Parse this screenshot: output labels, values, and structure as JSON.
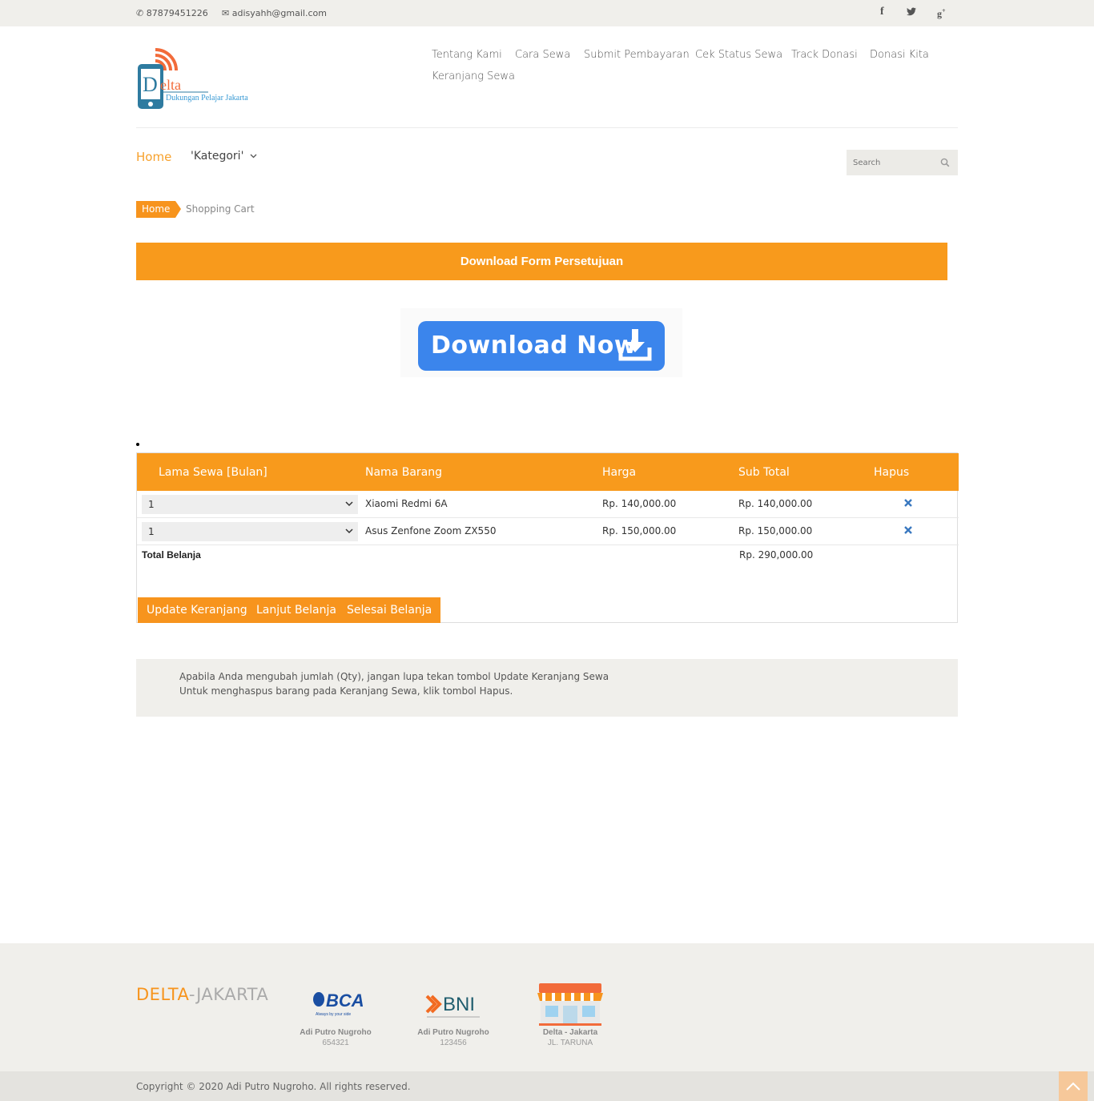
{
  "topbar": {
    "phone": "87879451226",
    "email": "adisyahh@gmail.com",
    "social": [
      "facebook-icon",
      "twitter-icon",
      "google-plus-icon"
    ]
  },
  "logo": {
    "letter": "D",
    "name": "elta",
    "tagline": "Dukungan Pelajar Jakarta"
  },
  "nav_top": [
    "Tentang Kami",
    "Cara Sewa",
    "Submit Pembayaran",
    "Cek Status Sewa",
    "Track Donasi",
    "Donasi Kita",
    "Keranjang Sewa"
  ],
  "menu": {
    "home": "Home",
    "kategori": "'Kategori'"
  },
  "search": {
    "placeholder": "Search"
  },
  "breadcrumb": {
    "home": "Home",
    "current": "Shopping Cart"
  },
  "download_form_label": "Download Form Persetujuan",
  "download_now_label": "Download Now",
  "cart": {
    "headers": [
      "Lama Sewa [Bulan]",
      "Nama Barang",
      "Harga",
      "Sub Total",
      "Hapus"
    ],
    "rows": [
      {
        "qty": "1",
        "name": "Xiaomi Redmi 6A",
        "price": "Rp. 140,000.00",
        "subtotal": "Rp. 140,000.00"
      },
      {
        "qty": "1",
        "name": "Asus Zenfone Zoom ZX550",
        "price": "Rp. 150,000.00",
        "subtotal": "Rp. 150,000.00"
      }
    ],
    "total_label": "Total Belanja",
    "total_value": "Rp. 290,000.00",
    "buttons": [
      "Update Keranjang",
      "Lanjut Belanja",
      "Selesai Belanja"
    ]
  },
  "note": [
    "Apabila Anda mengubah jumlah (Qty), jangan lupa tekan tombol Update Keranjang Sewa",
    "Untuk menghaspus barang pada Keranjang Sewa, klik tombol Hapus."
  ],
  "footer": {
    "brand_a": "DELTA",
    "brand_b": "-JAKARTA",
    "items": [
      {
        "logo": "BCA",
        "slogan": "Always by your side",
        "name": "Adi Putro Nugroho",
        "value": "654321"
      },
      {
        "logo": "BNI",
        "name": "Adi Putro Nugroho",
        "value": "123456"
      },
      {
        "logo": "store-icon",
        "name": "Delta - Jakarta",
        "value": "JL. TARUNA"
      }
    ],
    "copyright": "Copyright © 2020 Adi Putro Nugroho. All rights reserved."
  },
  "colors": {
    "accent": "#f7941d",
    "button_blue": "#3b85ec",
    "light_bg": "#f0efeb"
  }
}
